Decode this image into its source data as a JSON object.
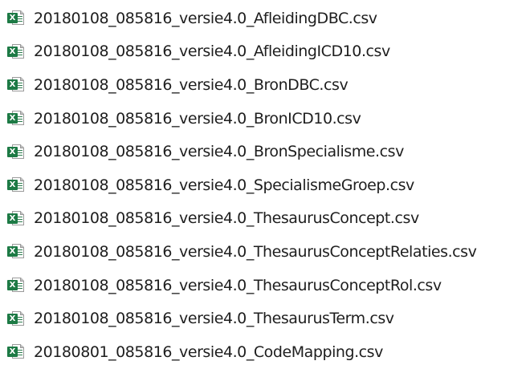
{
  "icon": {
    "name": "excel-csv-file-icon",
    "badge_letter": "X",
    "badge_color": "#1d7a45"
  },
  "files": [
    {
      "name": "20180108_085816_versie4.0_AfleidingDBC.csv"
    },
    {
      "name": "20180108_085816_versie4.0_AfleidingICD10.csv"
    },
    {
      "name": "20180108_085816_versie4.0_BronDBC.csv"
    },
    {
      "name": "20180108_085816_versie4.0_BronICD10.csv"
    },
    {
      "name": "20180108_085816_versie4.0_BronSpecialisme.csv"
    },
    {
      "name": "20180108_085816_versie4.0_SpecialismeGroep.csv"
    },
    {
      "name": "20180108_085816_versie4.0_ThesaurusConcept.csv"
    },
    {
      "name": "20180108_085816_versie4.0_ThesaurusConceptRelaties.csv"
    },
    {
      "name": "20180108_085816_versie4.0_ThesaurusConceptRol.csv"
    },
    {
      "name": "20180108_085816_versie4.0_ThesaurusTerm.csv"
    },
    {
      "name": "20180801_085816_versie4.0_CodeMapping.csv"
    }
  ]
}
